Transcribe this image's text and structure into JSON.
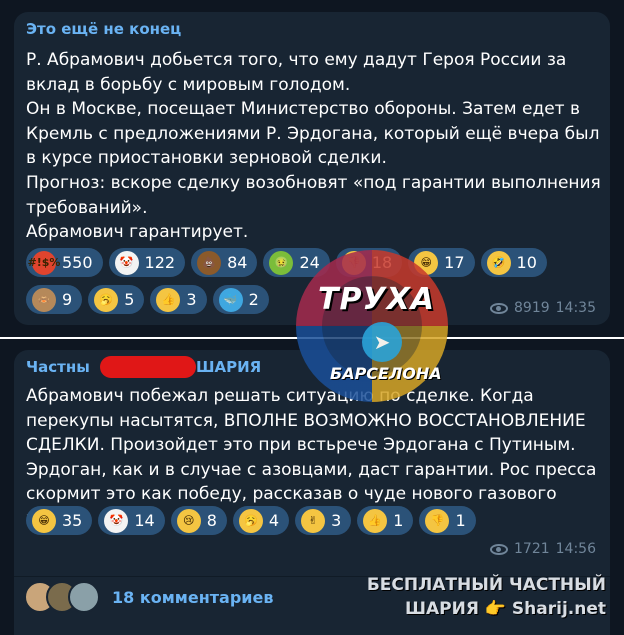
{
  "post1": {
    "sender": "Это ещё не конец",
    "paragraphs": [
      "Р. Абрамович добьется того, что ему дадут Героя России за вклад в борьбу с мировым голодом.",
      "Он в Москве, посещает Министерство обороны. Затем едет в Кремль с предложениями Р. Эрдогана, который ещё вчера был в курсе приостановки зерновой сделки.",
      "Прогноз: вскоре сделку возобновят «под гарантии выполнения требований».",
      "Абрамович гарантирует."
    ],
    "reactions_row1": [
      {
        "icon": "rage-emoji-icon",
        "emoji": "#!$%",
        "color": "#e0442e",
        "count": "550"
      },
      {
        "icon": "clown-emoji-icon",
        "emoji": "🤡",
        "color": "#f3f3f3",
        "count": "122"
      },
      {
        "icon": "poop-emoji-icon",
        "emoji": "💩",
        "color": "#8b5a2b",
        "count": "84"
      },
      {
        "icon": "nauseated-emoji-icon",
        "emoji": "🤢",
        "color": "#7bbd3a",
        "count": "24"
      },
      {
        "icon": "thumbs-down-emoji-icon",
        "emoji": "👎",
        "color": "#f4c542",
        "count": "18"
      },
      {
        "icon": "grin-emoji-icon",
        "emoji": "😁",
        "color": "#f4c542",
        "count": "17"
      },
      {
        "icon": "rofl-emoji-icon",
        "emoji": "🤣",
        "color": "#f4c542",
        "count": "10"
      }
    ],
    "reactions_row2": [
      {
        "icon": "see-no-evil-monkey-emoji-icon",
        "emoji": "🙈",
        "color": "#b5895a",
        "count": "9"
      },
      {
        "icon": "yawn-emoji-icon",
        "emoji": "🥱",
        "color": "#f4c542",
        "count": "5"
      },
      {
        "icon": "thumbs-up-emoji-icon",
        "emoji": "👍",
        "color": "#f4c542",
        "count": "3"
      },
      {
        "icon": "whale-emoji-icon",
        "emoji": "🐳",
        "color": "#3fa7e0",
        "count": "2"
      }
    ],
    "views": "8919",
    "time": "14:35"
  },
  "post2": {
    "sender_left": "Частны",
    "sender_right": "ШАРИЯ",
    "paragraphs": [
      "Абрамович побежал решать ситуацию по сделке. Когда перекупы насытятся, ВПОЛНЕ ВОЗМОЖНО ВОССТАНОВЛЕНИЕ СДЕЛКИ. Произойдет это при встьрече Эрдогана с Путиным. Эрдоган, как и в случае с азовцами, даст гарантии. Рос пресса скормит это как победу, рассказав о чуде нового газового хаба."
    ],
    "reactions": [
      {
        "icon": "grin-emoji-icon",
        "emoji": "😁",
        "color": "#f4c542",
        "count": "35"
      },
      {
        "icon": "clown-emoji-icon",
        "emoji": "🤡",
        "color": "#f3f3f3",
        "count": "14"
      },
      {
        "icon": "crying-emoji-icon",
        "emoji": "😢",
        "color": "#f4c542",
        "count": "8"
      },
      {
        "icon": "yawn-emoji-icon",
        "emoji": "🥱",
        "color": "#f4c542",
        "count": "4"
      },
      {
        "icon": "victory-hand-emoji-icon",
        "emoji": "✌",
        "color": "#f4c542",
        "count": "3"
      },
      {
        "icon": "thumbs-up-emoji-icon",
        "emoji": "👍",
        "color": "#f4c542",
        "count": "1"
      },
      {
        "icon": "thumbs-down-emoji-icon",
        "emoji": "👎",
        "color": "#f4c542",
        "count": "1"
      }
    ],
    "views": "1721",
    "time": "14:56",
    "comments_label": "18 комментариев"
  },
  "watermark": {
    "title": "ТРУХА",
    "subtitle": "БАРСЕЛОНА"
  },
  "brand": {
    "line1": "БЕСПЛАТНЫЙ ЧАСТНЫЙ",
    "line2": "ШАРИЯ 👉 Sharij.net"
  },
  "colors": {
    "background": "#0e1621",
    "bubble": "#182533",
    "accent": "#6ab3f3",
    "reaction_chip": "#2b5278",
    "meta": "#708599"
  }
}
